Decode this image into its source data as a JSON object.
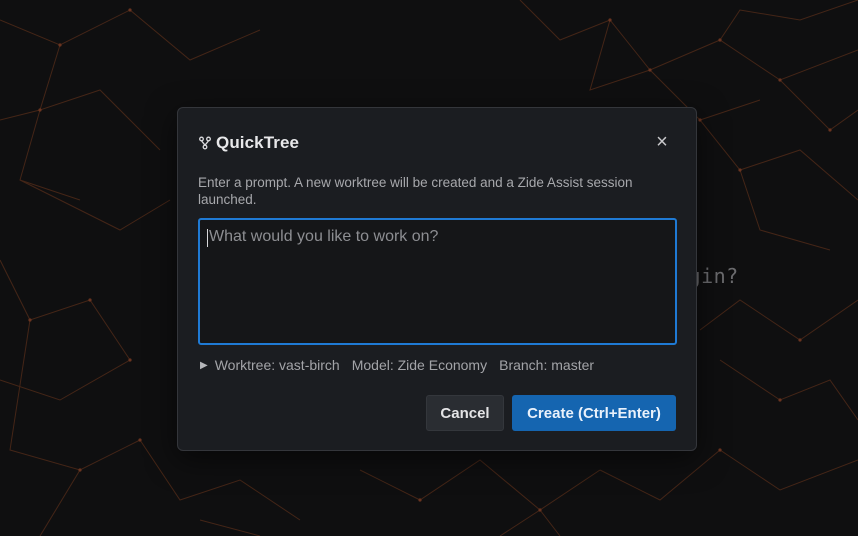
{
  "background": {
    "partial_text": "egin?"
  },
  "dialog": {
    "title": "QuickTree",
    "title_icon": "git-branch-icon",
    "close_icon": "close-icon",
    "close_glyph": "×",
    "description": "Enter a prompt. A new worktree will be created and a Zide Assist session launched.",
    "prompt": {
      "value": "",
      "placeholder": "What would you like to work on?"
    },
    "meta": {
      "toggle_glyph": "▶",
      "worktree": "Worktree: vast-birch",
      "model": "Model: Zide Economy",
      "branch": "Branch: master"
    },
    "buttons": {
      "cancel": "Cancel",
      "create": "Create (Ctrl+Enter)"
    }
  },
  "colors": {
    "accent": "#1f7ad4",
    "primary_button": "#1565b0",
    "dialog_bg": "#1b1d21",
    "network_lines": "#5a2e1c"
  }
}
